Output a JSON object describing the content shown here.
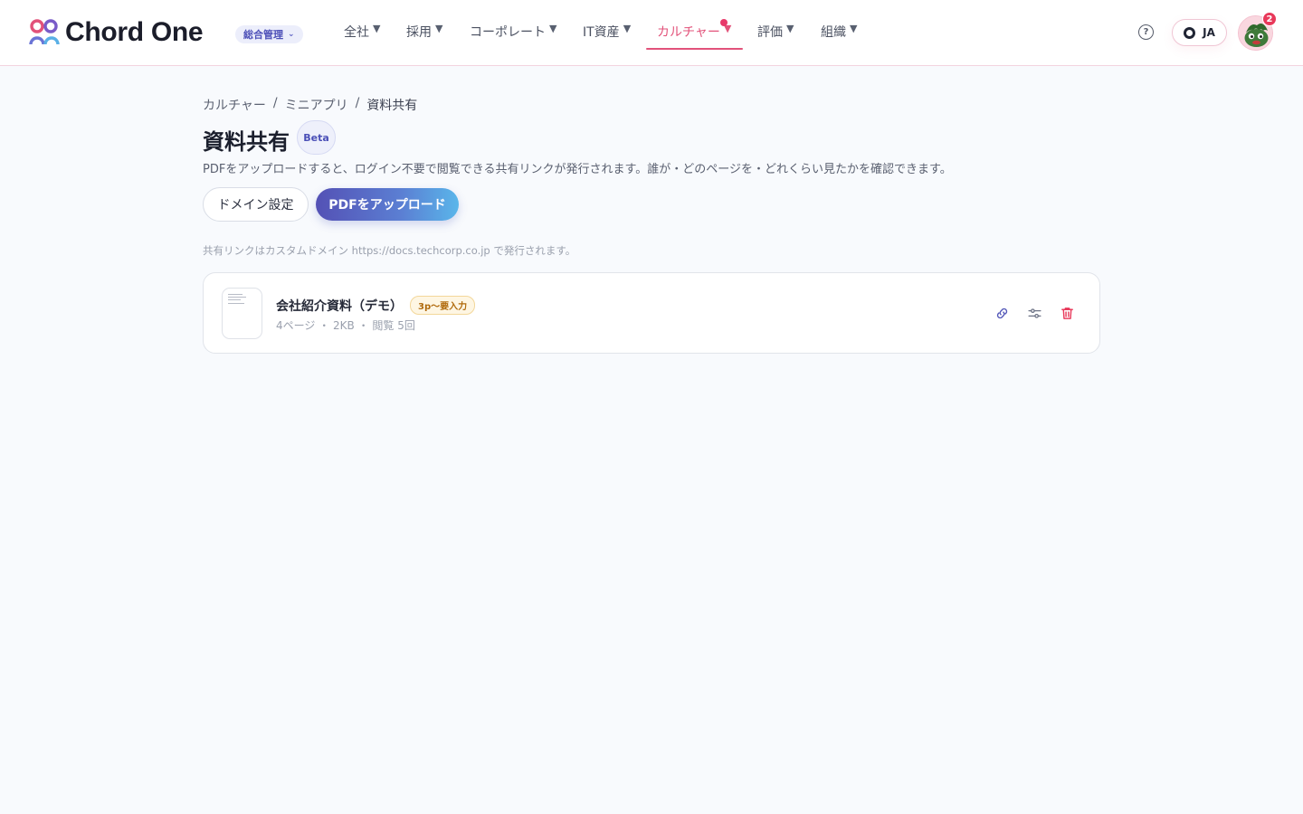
{
  "app": {
    "brand_name": "Chord One",
    "role_label": "総合管理"
  },
  "nav": {
    "items": [
      {
        "label": "全社"
      },
      {
        "label": "採用"
      },
      {
        "label": "コーポレート"
      },
      {
        "label": "IT資産"
      },
      {
        "label": "カルチャー",
        "active": true
      },
      {
        "label": "評価"
      },
      {
        "label": "組織"
      }
    ],
    "dropdown_glyph": "▼"
  },
  "header": {
    "help_glyph": "?",
    "language": "JA",
    "notification_count": "2"
  },
  "breadcrumb": {
    "items": [
      "カルチャー",
      "ミニアプリ",
      "資料共有"
    ],
    "separator": "/"
  },
  "page": {
    "title": "資料共有",
    "badge": "Beta",
    "description": "PDFをアップロードすると、ログイン不要で閲覧できる共有リンクが発行されます。誰が・どのページを・どれくらい見たかを確認できます。",
    "domain_button": "ドメイン設定",
    "upload_button": "PDFをアップロード",
    "domain_note": "共有リンクはカスタムドメイン https://docs.techcorp.co.jp で発行されます。"
  },
  "documents": [
    {
      "title": "会社紹介資料（デモ）",
      "tag": "3p〜要入力",
      "meta": "4ページ ・ 2KB ・ 閲覧 5回"
    }
  ],
  "colors": {
    "accent": "#e2527a",
    "primary": "#5451b5",
    "danger": "#e8395a",
    "background": "#f8fafd"
  },
  "icons": {
    "card_actions": [
      "link-icon",
      "sliders-icon",
      "trash-icon"
    ],
    "header": [
      "help-icon",
      "globe-icon"
    ]
  }
}
